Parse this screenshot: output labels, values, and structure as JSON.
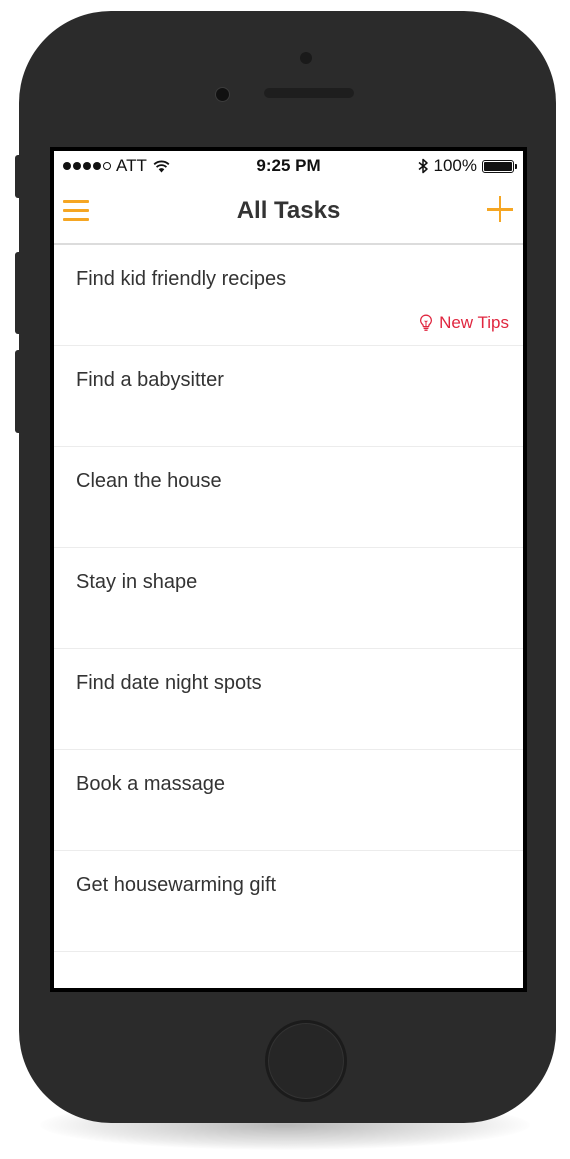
{
  "status_bar": {
    "carrier": "ATT",
    "time": "9:25 PM",
    "battery": "100%",
    "battery_level": 1.0,
    "signal_bars_filled": 4,
    "signal_bars_total": 5,
    "icons": [
      "wifi-icon",
      "bluetooth-icon",
      "battery-icon"
    ]
  },
  "nav": {
    "title": "All Tasks",
    "left_icon": "menu-icon",
    "right_icon": "plus-icon"
  },
  "tasks": [
    {
      "title": "Find kid friendly recipes",
      "badge": "New Tips",
      "badge_icon": "lightbulb-icon"
    },
    {
      "title": "Find a babysitter"
    },
    {
      "title": "Clean the house"
    },
    {
      "title": "Stay in shape"
    },
    {
      "title": "Find date night spots"
    },
    {
      "title": "Book a massage"
    },
    {
      "title": "Get housewarming gift"
    }
  ],
  "colors": {
    "accent": "#f5a623",
    "tips": "#e0263f",
    "text": "#333333",
    "device": "#2b2b2b"
  }
}
